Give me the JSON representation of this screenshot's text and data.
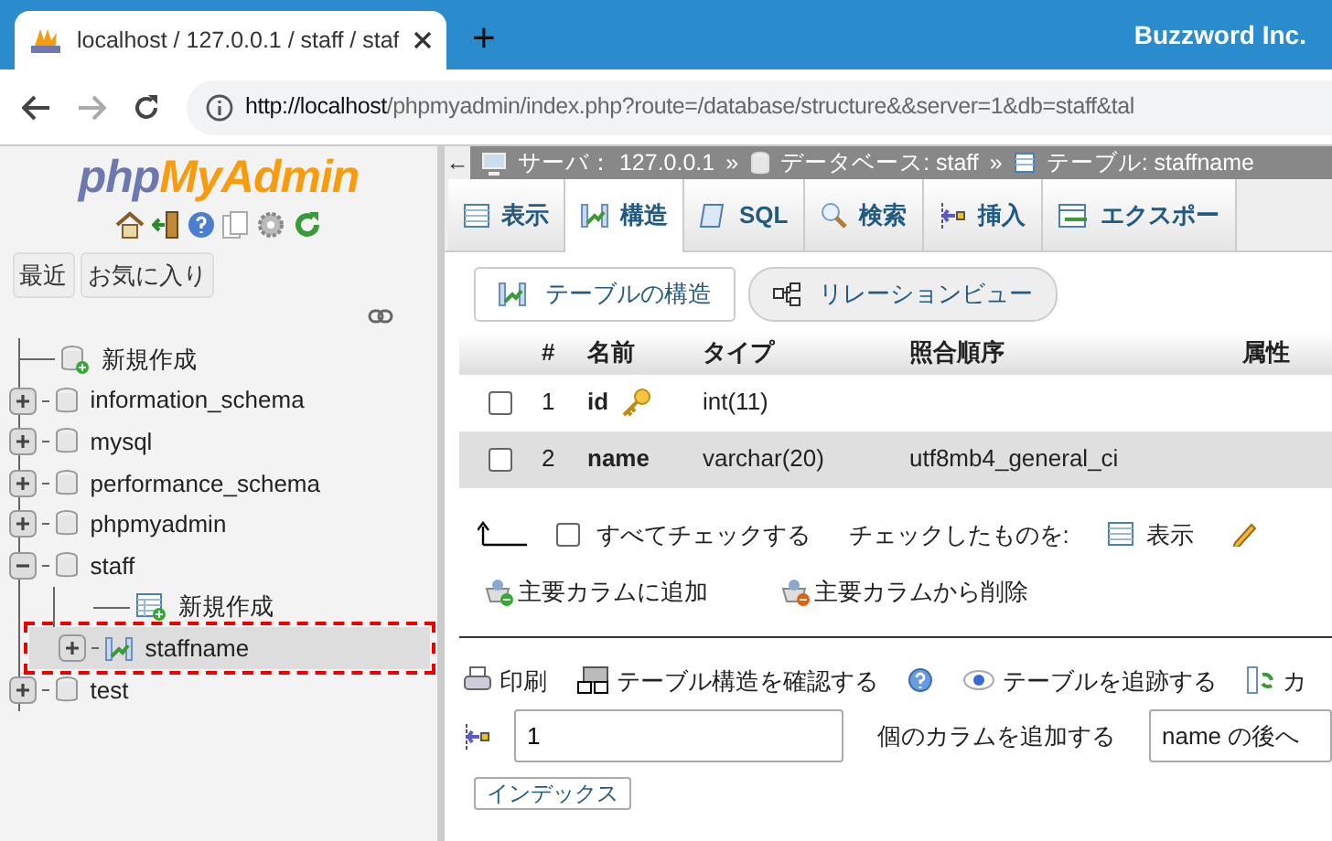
{
  "browser": {
    "tab_title": "localhost / 127.0.0.1 / staff / staf",
    "new_tab": "+",
    "brand": "Buzzword Inc.",
    "url_host": "http://localhost",
    "url_rest": "/phpmyadmin/index.php?route=/database/structure&&server=1&db=staff&tal"
  },
  "sidebar": {
    "logo_left": "php",
    "logo_right": "MyAdmin",
    "buttons": [
      "最近",
      "お気に入り"
    ],
    "tree": [
      {
        "kind": "new",
        "label": "新規作成"
      },
      {
        "kind": "database",
        "label": "information_schema",
        "expanded": false
      },
      {
        "kind": "database",
        "label": "mysql",
        "expanded": false
      },
      {
        "kind": "database",
        "label": "performance_schema",
        "expanded": false
      },
      {
        "kind": "database",
        "label": "phpmyadmin",
        "expanded": false
      },
      {
        "kind": "database",
        "label": "staff",
        "expanded": true,
        "children": [
          {
            "kind": "new",
            "label": "新規作成"
          },
          {
            "kind": "table",
            "label": "staffname",
            "expanded": false,
            "highlighted": true
          }
        ]
      },
      {
        "kind": "database",
        "label": "test",
        "expanded": false
      }
    ]
  },
  "breadcrumb_collapse": "←",
  "breadcrumb": [
    {
      "kind": "server",
      "text": "サーバ： 127.0.0.1"
    },
    {
      "kind": "database",
      "separator": "»",
      "text": "データベース: staff"
    },
    {
      "kind": "table",
      "separator": "»",
      "text": "テーブル: staffname"
    }
  ],
  "tabs": [
    {
      "kind": "browse",
      "label": "表示",
      "selected": false
    },
    {
      "kind": "structure",
      "label": "構造",
      "selected": true
    },
    {
      "kind": "sql",
      "label": "SQL",
      "selected": false
    },
    {
      "kind": "search",
      "label": "検索",
      "selected": false
    },
    {
      "kind": "insert",
      "label": "挿入",
      "selected": false
    },
    {
      "kind": "export",
      "label": "エクスポー",
      "selected": false
    }
  ],
  "subtabs": [
    {
      "kind": "structure",
      "label": "テーブルの構造",
      "selected": true
    },
    {
      "kind": "relation",
      "label": "リレーションビュー",
      "selected": false
    }
  ],
  "table": {
    "columns": [
      "#",
      "名前",
      "タイプ",
      "照合順序",
      "属性"
    ],
    "rows": [
      {
        "checked": false,
        "number": "1",
        "name": "id",
        "primary_key": true,
        "type": "int(11)"
      },
      {
        "checked": false,
        "number": "2",
        "name": "name",
        "primary_key": false,
        "type": "varchar(20)",
        "collation": "utf8mb4_general_ci"
      }
    ]
  },
  "bulk": {
    "check_all": {
      "label": "すべてチェックする",
      "checked": false
    },
    "with_selected": "チェックしたものを:",
    "actions": [
      {
        "kind": "browse",
        "label": "表示"
      },
      {
        "kind": "edit"
      }
    ]
  },
  "central_columns": [
    {
      "kind": "add",
      "label": "主要カラムに追加"
    },
    {
      "kind": "remove",
      "label": "主要カラムから削除"
    }
  ],
  "tools": [
    {
      "kind": "print",
      "label": "印刷"
    },
    {
      "kind": "propose",
      "label": "テーブル構造を確認する",
      "help": true
    },
    {
      "kind": "track",
      "label": "テーブルを追跡する"
    },
    {
      "kind": "move",
      "label": "カ"
    }
  ],
  "add_columns": {
    "count": "1",
    "label": "個のカラムを追加する",
    "position": "name の後へ"
  },
  "index_button": "インデックス"
}
